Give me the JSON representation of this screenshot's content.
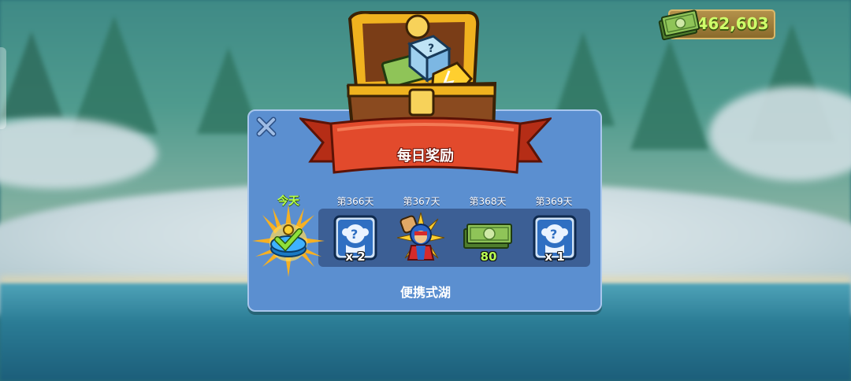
{
  "currency": {
    "cash": "462,603",
    "icon": "cash-stack-icon",
    "color": "#c8ff5a"
  },
  "dialog": {
    "title": "每日奖励",
    "close_icon": "close-icon",
    "location": "便携式湖",
    "today_label": "今天",
    "days": [
      {
        "label": "第366天",
        "reward": "mystery-monkey-icon",
        "count": "x 2"
      },
      {
        "label": "第367天",
        "reward": "hero-skin-icon",
        "count": ""
      },
      {
        "label": "第368天",
        "reward": "cash-stack-icon",
        "count": "80"
      },
      {
        "label": "第369天",
        "reward": "mystery-monkey-icon",
        "count": "x 1"
      }
    ]
  },
  "colors": {
    "panel": "#5b8fd0",
    "banner": "#e24a2c",
    "accent_green": "#b7ff4a"
  }
}
